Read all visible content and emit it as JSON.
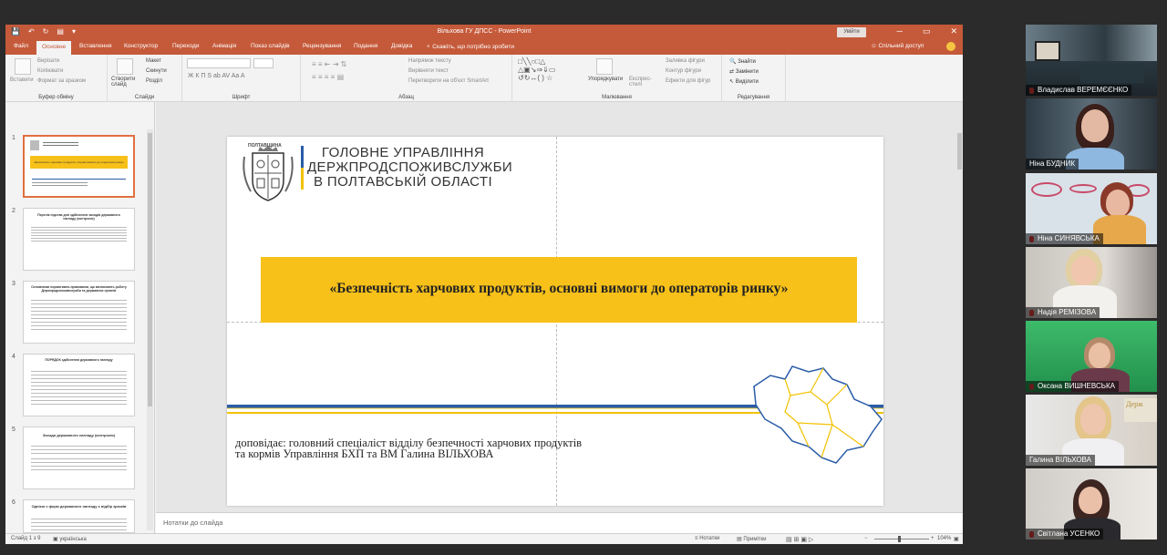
{
  "window": {
    "title": "Вільхова ГУ ДПСС - PowerPoint",
    "sign_in": "Увійти",
    "controls": [
      "─",
      "▭",
      "✕"
    ]
  },
  "ribbon_tabs": {
    "items": [
      "Файл",
      "Основне",
      "Вставлення",
      "Конструктор",
      "Переходи",
      "Анімація",
      "Показ слайдів",
      "Рецензування",
      "Подання",
      "Довідка"
    ],
    "active": "Основне",
    "tell_me": "Скажіть, що потрібно зробити",
    "share": "Спільний доступ"
  },
  "ribbon": {
    "clipboard": {
      "label": "Буфер обміну",
      "paste": "Вставити",
      "cut": "Вирізати",
      "copy": "Копіювати",
      "format": "Формат за зразком"
    },
    "slides": {
      "label": "Слайди",
      "new_slide": "Створити слайд",
      "layout": "Макет",
      "reset": "Скинути",
      "section": "Розділ"
    },
    "font": {
      "label": "Шрифт",
      "style_glyphs": "Ж  К  П  S  ab  AV  Aa  A"
    },
    "paragraph": {
      "label": "Абзац",
      "direction": "Напрямок тексту",
      "align": "Вирівняти текст",
      "smartart": "Перетворити на об'єкт SmartArt"
    },
    "drawing": {
      "label": "Малювання",
      "arrange": "Упорядкувати",
      "quick_styles": "Експрес-стилі",
      "fill": "Заливка фігури",
      "outline": "Контур фігури",
      "effects": "Ефекти для фігур"
    },
    "editing": {
      "label": "Редагування",
      "find": "Знайти",
      "replace": "Замінити",
      "select": "Виділити"
    }
  },
  "thumbnails": [
    {
      "num": "1",
      "title": "«Безпечність харчових продуктів, основні вимоги до операторів ринку»"
    },
    {
      "num": "2",
      "title": "Перелік підстав для здійснення заходів державного нагляду (контролю)"
    },
    {
      "num": "3",
      "title": "Основними нормативно-правовими, що визначають роботу Держпродспоживслужби та державних органів"
    },
    {
      "num": "4",
      "title": "ПОРЯДОК здійснення державного нагляду"
    },
    {
      "num": "5",
      "title": "Заходи державного нагляду (контролю)"
    },
    {
      "num": "6",
      "title": "Однією з форм державного нагляду є відбір зразків"
    }
  ],
  "slide": {
    "crest_label": "ПОЛТАВЩИНА",
    "org_line1": "ГОЛОВНЕ УПРАВЛІННЯ",
    "org_line2": "ДЕРЖПРОДСПОЖИВСЛУЖБИ",
    "org_line3": "В ПОЛТАВСЬКІЙ ОБЛАСТІ",
    "banner_title": "«Безпечність харчових продуктів, основні вимоги до операторів ринку»",
    "speaker_line1": "доповідає: головний спеціаліст відділу безпечності харчових продуктів",
    "speaker_line2": "та кормів Управління БХП та ВМ  Галина ВІЛЬХОВА",
    "colors": {
      "banner": "#f7c11a",
      "blue": "#2a5ca8",
      "yellow": "#f2c200"
    }
  },
  "notes_placeholder": "Нотатки до слайда",
  "statusbar": {
    "slide_counter": "Слайд 1 з 9",
    "language": "українська",
    "notes": "Нотатки",
    "comments": "Примітки",
    "zoom": "104%"
  },
  "participants": [
    {
      "name": "Владислав ВЕРЕМЄЄНКО",
      "muted": true,
      "active": false
    },
    {
      "name": "Ніна БУДНИК",
      "muted": false,
      "active": true
    },
    {
      "name": "Ніна СИНЯВСЬКА",
      "muted": true,
      "active": false
    },
    {
      "name": "Надія РЕМІЗОВА",
      "muted": true,
      "active": false
    },
    {
      "name": "Оксана ВИШНЕВСЬКА",
      "muted": true,
      "active": false
    },
    {
      "name": "Галина ВІЛЬХОВА",
      "muted": false,
      "active": false
    },
    {
      "name": "Світлана УСЕНКО",
      "muted": true,
      "active": false
    }
  ]
}
